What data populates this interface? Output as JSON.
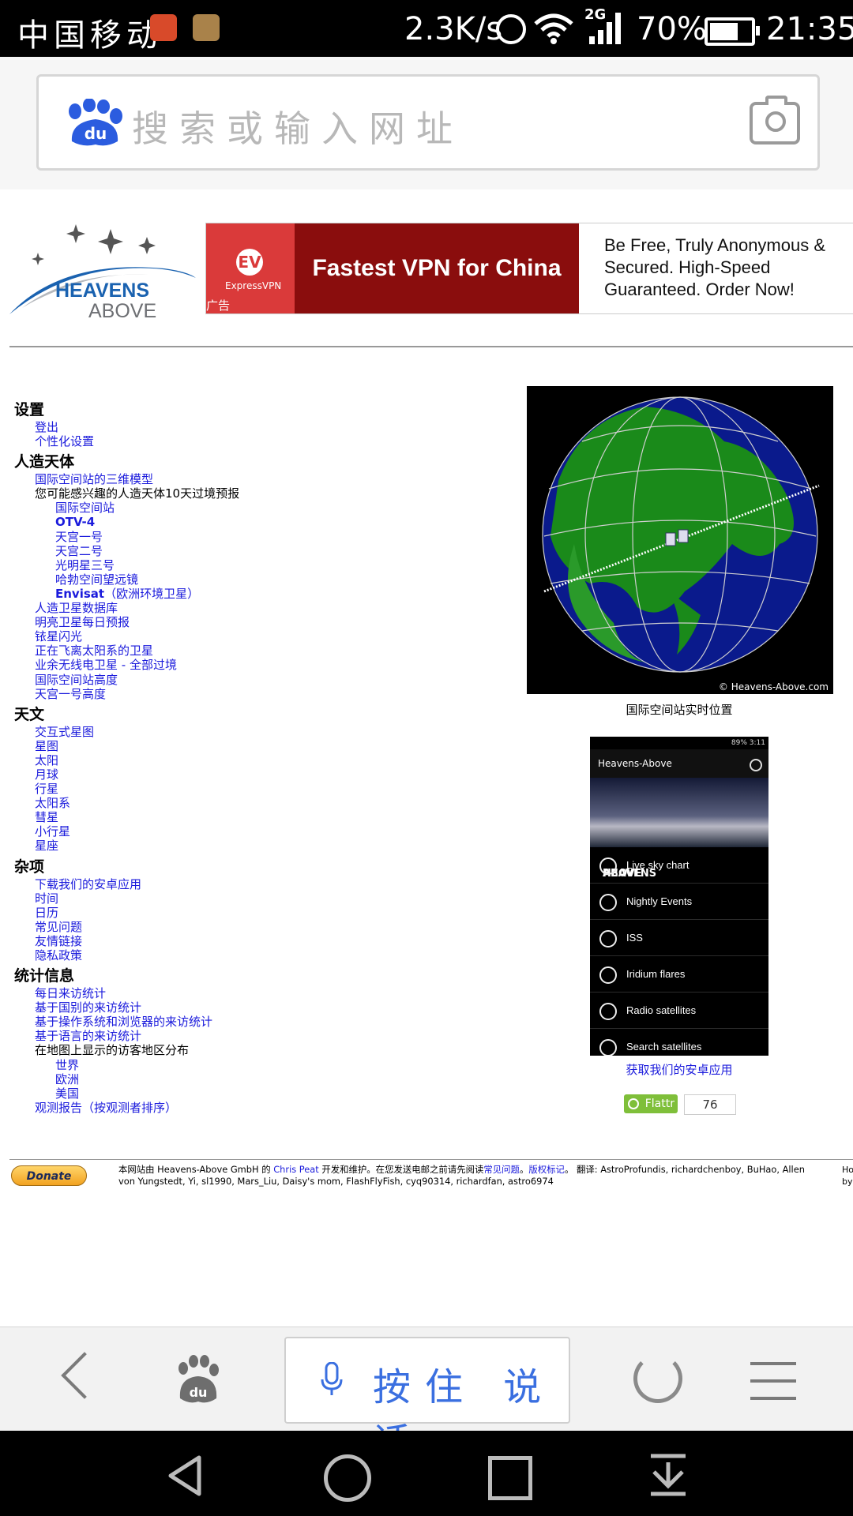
{
  "status_bar": {
    "carrier": "中国移动",
    "net_speed": "2.3K/s",
    "network_tag": "2G",
    "battery_pct": "70%",
    "battery_level": 0.7,
    "time": "21:35"
  },
  "browser": {
    "search_placeholder": "搜索或输入网址",
    "voice_label": "按住 说话"
  },
  "site": {
    "logo_line1": "HEAVENS",
    "logo_line2": "ABOVE",
    "ad": {
      "brand": "ExpressVPN",
      "brand_mark": "EV",
      "ad_tag": "广告",
      "headline": "Fastest VPN for China",
      "desc": "Be Free, Truly Anonymous & Secured. High-Speed Guaranteed. Order Now!"
    },
    "menu": [
      {
        "type": "cat",
        "text": "设置"
      },
      {
        "type": "link",
        "level": 1,
        "text": "登出"
      },
      {
        "type": "link",
        "level": 1,
        "text": "个性化设置"
      },
      {
        "type": "cat",
        "text": "人造天体"
      },
      {
        "type": "link",
        "level": 1,
        "text": "国际空间站的三维模型"
      },
      {
        "type": "text",
        "level": 1,
        "text": "您可能感兴趣的人造天体10天过境预报"
      },
      {
        "type": "link",
        "level": 2,
        "text": "国际空间站"
      },
      {
        "type": "link",
        "level": 2,
        "text": "OTV-4",
        "bold": true
      },
      {
        "type": "link",
        "level": 2,
        "text": "天宫一号"
      },
      {
        "type": "link",
        "level": 2,
        "text": "天宫二号"
      },
      {
        "type": "link",
        "level": 2,
        "text": "光明星三号"
      },
      {
        "type": "link",
        "level": 2,
        "text": "哈勃空间望远镜"
      },
      {
        "type": "link",
        "level": 2,
        "text": "Envisat（欧洲环境卫星）",
        "boldprefix": "Envisat"
      },
      {
        "type": "link",
        "level": 1,
        "text": "人造卫星数据库"
      },
      {
        "type": "link",
        "level": 1,
        "text": "明亮卫星每日预报"
      },
      {
        "type": "link",
        "level": 1,
        "text": "铱星闪光"
      },
      {
        "type": "link",
        "level": 1,
        "text": "正在飞离太阳系的卫星"
      },
      {
        "type": "link",
        "level": 1,
        "text": "业余无线电卫星 - 全部过境"
      },
      {
        "type": "link",
        "level": 1,
        "text": "国际空间站高度"
      },
      {
        "type": "link",
        "level": 1,
        "text": "天宫一号高度"
      },
      {
        "type": "cat",
        "text": "天文"
      },
      {
        "type": "link",
        "level": 1,
        "text": "交互式星图"
      },
      {
        "type": "link",
        "level": 1,
        "text": "星图"
      },
      {
        "type": "link",
        "level": 1,
        "text": "太阳"
      },
      {
        "type": "link",
        "level": 1,
        "text": "月球"
      },
      {
        "type": "link",
        "level": 1,
        "text": "行星"
      },
      {
        "type": "link",
        "level": 1,
        "text": "太阳系"
      },
      {
        "type": "link",
        "level": 1,
        "text": "彗星"
      },
      {
        "type": "link",
        "level": 1,
        "text": "小行星"
      },
      {
        "type": "link",
        "level": 1,
        "text": "星座"
      },
      {
        "type": "cat",
        "text": "杂项"
      },
      {
        "type": "link",
        "level": 1,
        "text": "下载我们的安卓应用"
      },
      {
        "type": "link",
        "level": 1,
        "text": "时间"
      },
      {
        "type": "link",
        "level": 1,
        "text": "日历"
      },
      {
        "type": "link",
        "level": 1,
        "text": "常见问题"
      },
      {
        "type": "link",
        "level": 1,
        "text": "友情链接"
      },
      {
        "type": "link",
        "level": 1,
        "text": "隐私政策"
      },
      {
        "type": "cat",
        "text": "统计信息"
      },
      {
        "type": "link",
        "level": 1,
        "text": "每日来访统计"
      },
      {
        "type": "link",
        "level": 1,
        "text": "基于国别的来访统计"
      },
      {
        "type": "link",
        "level": 1,
        "text": "基于操作系统和浏览器的来访统计"
      },
      {
        "type": "link",
        "level": 1,
        "text": "基于语言的来访统计"
      },
      {
        "type": "text",
        "level": 1,
        "text": "在地图上显示的访客地区分布"
      },
      {
        "type": "link",
        "level": 2,
        "text": "世界"
      },
      {
        "type": "link",
        "level": 2,
        "text": "欧洲"
      },
      {
        "type": "link",
        "level": 2,
        "text": "美国"
      },
      {
        "type": "link",
        "level": 1,
        "text": "观测报告（按观测者排序）"
      }
    ],
    "globe_credit": "© Heavens-Above.com",
    "globe_caption": "国际空间站实时位置",
    "app": {
      "status": "89% 3:11",
      "title": "Heavens-Above",
      "banner_line1": "HEAVENS",
      "banner_line2": "ABOVE",
      "items": [
        "Live sky chart",
        "Nightly Events",
        "ISS",
        "Iridium flares",
        "Radio satellites",
        "Search satellites"
      ]
    },
    "get_app": "获取我们的安卓应用",
    "flattr_label": "Flattr",
    "flattr_count": "76",
    "donate_label": "Donate",
    "footer": {
      "p1": "本网站由 Heavens-Above GmbH 的 ",
      "author": "Chris Peat",
      "p2": " 开发和维护。在您发送电邮之前请先阅读",
      "faq": "常见问题",
      "p3": "。",
      "copyright": "版权标记",
      "p4": "。 翻译:   AstroProfundis, richardchenboy, BuHao, Allen von Yungstedt, Yi, sl1990, Mars_Liu, Daisy's mom, FlashFlyFish, cyq90314, richardfan, astro6974",
      "cut1": "Ho",
      "cut2": "by"
    }
  },
  "colors": {
    "link": "#1a1adc",
    "voice": "#3a6fe0",
    "ad_red": "#da3a3a",
    "ad_dark": "#8a0d0d",
    "baidu_blue": "#2b5cdf"
  }
}
